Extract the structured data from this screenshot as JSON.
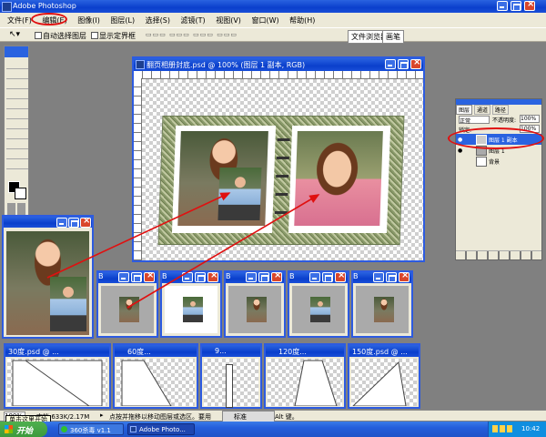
{
  "app": {
    "title": "Adobe Photoshop"
  },
  "menu": [
    "文件(F)",
    "编辑(E)",
    "图像(I)",
    "图层(L)",
    "选择(S)",
    "滤镜(T)",
    "视图(V)",
    "窗口(W)",
    "帮助(H)"
  ],
  "options_bar": {
    "auto_select_label": "自动选择图层",
    "show_bounds_label": "显示定界框",
    "tabs": [
      "文件浏览器",
      "画笔"
    ]
  },
  "main_doc": {
    "title": "翻页相册封底.psd @ 100% (图层 1 副本, RGB)"
  },
  "layers_panel": {
    "tabs": [
      "图层",
      "通道",
      "路径"
    ],
    "blend_mode": "正常",
    "opacity_label": "不透明度:",
    "opacity_value": "100%",
    "lock_label": "锁定:",
    "fill_value": "100%",
    "layers": [
      "图层 1 副本",
      "图层 1",
      "背景"
    ]
  },
  "small_docs": {
    "big_left": "",
    "row1": [
      "B",
      "B",
      "B",
      "B",
      "B"
    ],
    "row2": [
      "30度.psd @ ...",
      "60度...",
      "9...",
      "120度...",
      "150度.psd @ ..."
    ]
  },
  "status_bar": {
    "zoom": "100%",
    "doc_size": "文档:633K/2.17M",
    "hint": "点按并拖移以移动图层或选区。要用",
    "ime_label": "标准",
    "right_text": "Alt 键。"
  },
  "taskbar": {
    "start_label": "开始",
    "tooltip": "单击这里开始",
    "items": [
      "360杀毒 v1.1",
      "Adobe Photo..."
    ],
    "clock": "10:42"
  },
  "colors": {
    "xp_blue": "#2a63e0",
    "annotation_red": "#e01010",
    "taskbar_green": "#3c9a3c"
  }
}
